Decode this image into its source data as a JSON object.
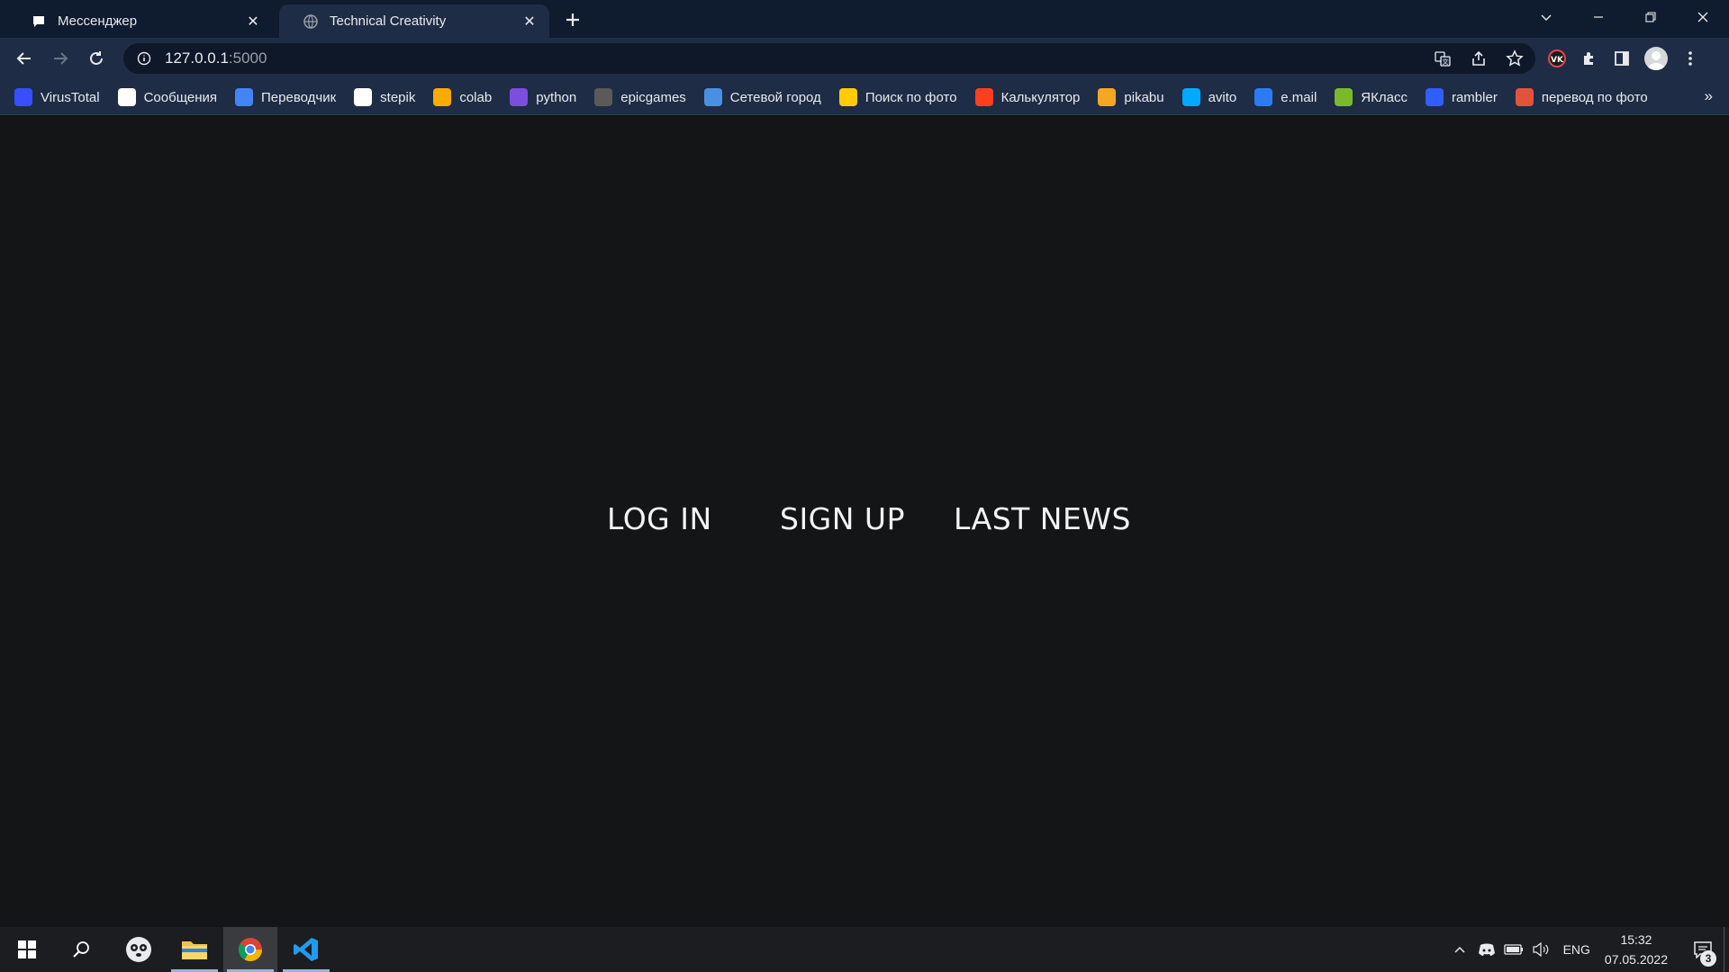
{
  "browser": {
    "tabs": [
      {
        "title": "Мессенджер",
        "active": false
      },
      {
        "title": "Technical Creativity",
        "active": true
      }
    ],
    "address": {
      "host": "127.0.0.1",
      "port": ":5000"
    },
    "bookmarks": [
      {
        "label": "VirusTotal",
        "icon": "virustotal-icon",
        "color": "#394eff"
      },
      {
        "label": "Сообщения",
        "icon": "chat-icon",
        "color": "#ffffff"
      },
      {
        "label": "Переводчик",
        "icon": "translate-icon",
        "color": "#4285f4"
      },
      {
        "label": "stepik",
        "icon": "stepik-icon",
        "color": "#ffffff"
      },
      {
        "label": "colab",
        "icon": "colab-icon",
        "color": "#f9ab00"
      },
      {
        "label": "python",
        "icon": "python-icon",
        "color": "#7b4ee0"
      },
      {
        "label": "epicgames",
        "icon": "epicgames-icon",
        "color": "#5a5a5a"
      },
      {
        "label": "Сетевой город",
        "icon": "netcity-icon",
        "color": "#4a90e2"
      },
      {
        "label": "Поиск по фото",
        "icon": "photo-search-icon",
        "color": "#ffcc00"
      },
      {
        "label": "Калькулятор",
        "icon": "yandex-icon",
        "color": "#fc3f1d"
      },
      {
        "label": "pikabu",
        "icon": "pikabu-icon",
        "color": "#f5a623"
      },
      {
        "label": "avito",
        "icon": "avito-icon",
        "color": "#00aaff"
      },
      {
        "label": "e.mail",
        "icon": "email-icon",
        "color": "#2d7bf4"
      },
      {
        "label": "ЯКласс",
        "icon": "yaklass-icon",
        "color": "#7ab929"
      },
      {
        "label": "rambler",
        "icon": "rambler-icon",
        "color": "#315efb"
      },
      {
        "label": "перевод по фото",
        "icon": "photo-translate-icon",
        "color": "#e2543a"
      }
    ],
    "more_label": "»"
  },
  "page": {
    "links": {
      "login": "LOG IN",
      "signup": "SIGN UP",
      "news": "LAST NEWS"
    }
  },
  "taskbar": {
    "language": "ENG",
    "time": "15:32",
    "date": "07.05.2022",
    "notifications": "3"
  },
  "colors": {
    "page_background": "#141517",
    "browser_chrome": "#1f2c46",
    "tabstrip": "#0f1b2e",
    "taskbar": "#1c1d20"
  }
}
